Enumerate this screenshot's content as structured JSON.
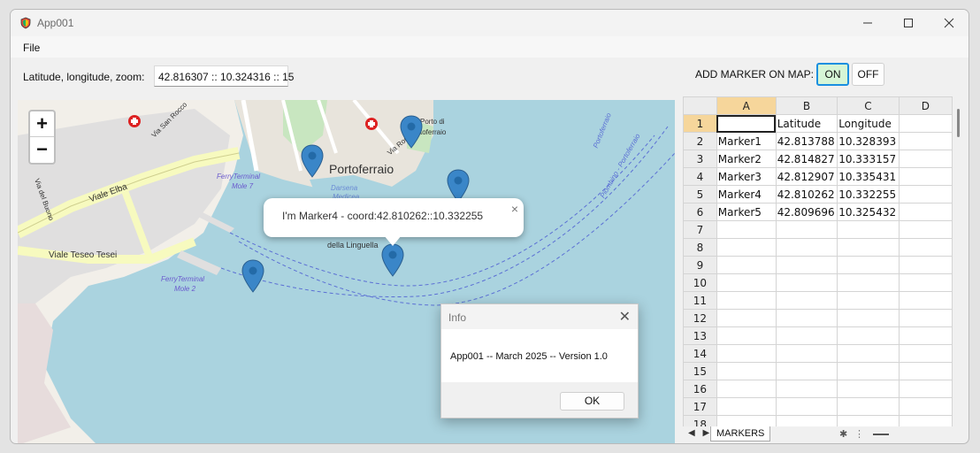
{
  "window": {
    "title": "App001"
  },
  "menu": {
    "file": "File"
  },
  "toolbar": {
    "coord_label": "Latitude, longitude, zoom:",
    "coord_value": "42.816307 :: 10.324316 :: 15",
    "add_marker_label": "ADD MARKER ON MAP:",
    "on_label": "ON",
    "off_label": "OFF"
  },
  "map": {
    "zoom_in": "+",
    "zoom_out": "−",
    "popup_text": "I'm Marker4 - coord:42.810262::10.332255",
    "popup_close": "×",
    "place_portoferraio": "Portoferraio",
    "labels": {
      "viale_elba": "Viale Elba",
      "viale_teseo": "Viale Teseo Tesei",
      "ferry7": "FerryTerminal",
      "mole7": "Mole 7",
      "ferry2": "FerryTerminal",
      "mole2": "Mole 2",
      "darsena": "Darsena",
      "medicea": "Medicea",
      "linguella": "della Linguella",
      "portoferraio_route": "Portoferraio",
      "piombino_route": "Piombino - Portoferraio",
      "porto_di": "Porto di",
      "toferraio": "toferraio",
      "via_roma": "Via Roma",
      "via_del_buono": "Via del Buono",
      "via_san_rocco": "Via San Rocco"
    },
    "marker_color": "#3a86c8"
  },
  "dialog": {
    "title": "Info",
    "message": "App001 -- March 2025 -- Version 1.0",
    "ok_label": "OK",
    "close": "✕"
  },
  "sheet": {
    "columns": [
      "A",
      "B",
      "C",
      "D"
    ],
    "rows": [
      [
        "",
        "Latitude",
        "Longitude",
        ""
      ],
      [
        "Marker1",
        "42.813788",
        "10.328393",
        ""
      ],
      [
        "Marker2",
        "42.814827",
        "10.333157",
        ""
      ],
      [
        "Marker3",
        "42.812907",
        "10.335431",
        ""
      ],
      [
        "Marker4",
        "42.810262",
        "10.332255",
        ""
      ],
      [
        "Marker5",
        "42.809696",
        "10.325432",
        ""
      ],
      [
        "",
        "",
        "",
        ""
      ],
      [
        "",
        "",
        "",
        ""
      ],
      [
        "",
        "",
        "",
        ""
      ],
      [
        "",
        "",
        "",
        ""
      ],
      [
        "",
        "",
        "",
        ""
      ],
      [
        "",
        "",
        "",
        ""
      ],
      [
        "",
        "",
        "",
        ""
      ],
      [
        "",
        "",
        "",
        ""
      ],
      [
        "",
        "",
        "",
        ""
      ],
      [
        "",
        "",
        "",
        ""
      ],
      [
        "",
        "",
        "",
        ""
      ],
      [
        "",
        "",
        "",
        ""
      ]
    ],
    "tab_name": "MARKERS"
  }
}
